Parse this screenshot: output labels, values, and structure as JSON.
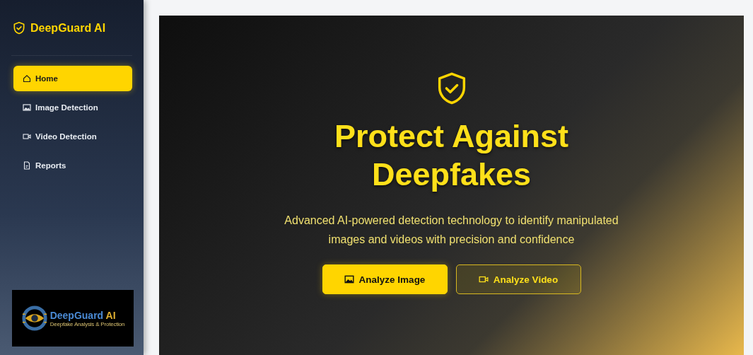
{
  "sidebar": {
    "brand": "DeepGuard AI",
    "items": [
      {
        "label": "Home",
        "kind": "home",
        "selected": true
      },
      {
        "label": "Image Detection",
        "kind": "image",
        "selected": false
      },
      {
        "label": "Video Detection",
        "kind": "video",
        "selected": false
      },
      {
        "label": "Reports",
        "kind": "report",
        "selected": false
      }
    ],
    "logo": {
      "name": "DeepGuard",
      "suffix": "AI",
      "tagline": "Deepfake Analysis & Protection"
    }
  },
  "hero": {
    "title": "Protect Against Deepfakes",
    "subtitle": "Advanced AI-powered detection technology to identify manipulated images and videos with precision and confidence",
    "buttons": [
      {
        "label": "Analyze Image",
        "kind": "primary"
      },
      {
        "label": "Analyze Video",
        "kind": "outline"
      }
    ]
  }
}
